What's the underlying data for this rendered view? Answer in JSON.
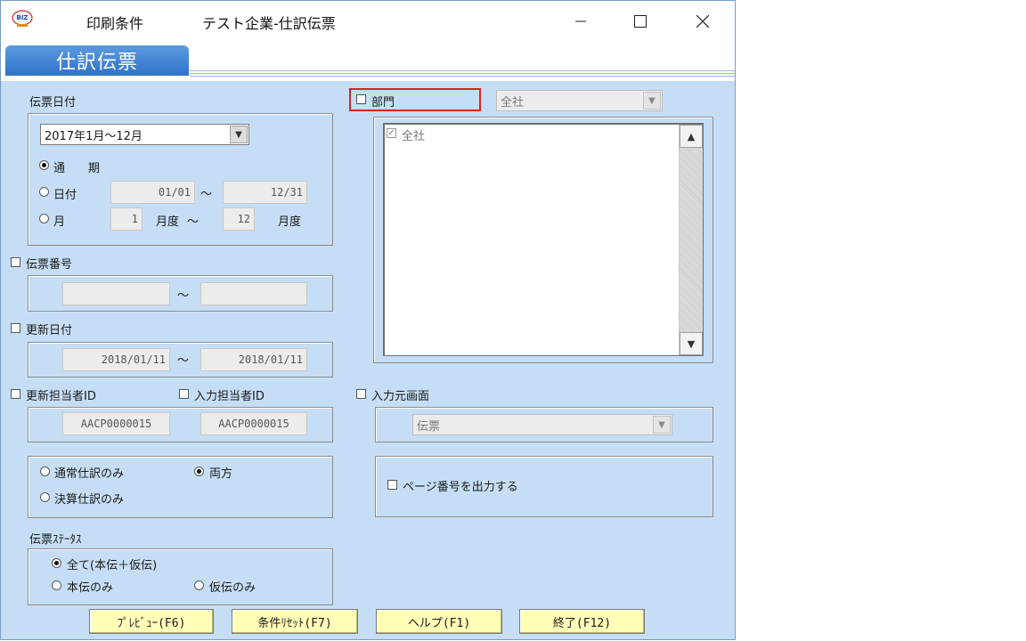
{
  "window": {
    "app_title": "印刷条件",
    "doc_title": "テスト企業-仕訳伝票",
    "minimize": "—",
    "maximize": "☐",
    "close": "✕"
  },
  "page_tab": "仕訳伝票",
  "slip_date": {
    "title": "伝票日付",
    "period_value": "2017年1月～12月",
    "radio_full": "通　　期",
    "radio_date": "日付",
    "date_from": "01/01",
    "tilde1": "～",
    "date_to": "12/31",
    "radio_month": "月",
    "month_from": "1",
    "month_unit1": "月度",
    "tilde2": "～",
    "month_to": "12",
    "month_unit2": "月度"
  },
  "slip_number": {
    "label": "伝票番号",
    "from": "",
    "tilde": "～",
    "to": ""
  },
  "update_date": {
    "label": "更新日付",
    "from": "2018/01/11",
    "tilde": "～",
    "to": "2018/01/11"
  },
  "persons": {
    "updater_label": "更新担当者ID",
    "updater_value": "AACP0000015",
    "inputter_label": "入力担当者ID",
    "inputter_value": "AACP0000015"
  },
  "journal_type": {
    "normal": "通常仕訳のみ",
    "both": "両方",
    "closing": "決算仕訳のみ"
  },
  "slip_status": {
    "title": "伝票ｽﾃｰﾀｽ",
    "all": "全て(本伝＋仮伝)",
    "main_only": "本伝のみ",
    "temp_only": "仮伝のみ"
  },
  "department": {
    "label": "部門",
    "combo_value": "全社",
    "list_items": [
      "全社"
    ]
  },
  "source_screen": {
    "label": "入力元画面",
    "combo_value": "伝票"
  },
  "page_number": {
    "label": "ページ番号を出力する"
  },
  "buttons": {
    "preview": "ﾌﾟﾚﾋﾞｭｰ(F6)",
    "reset": "条件ﾘｾｯﾄ(F7)",
    "help": "ヘルプ(F1)",
    "exit": "終了(F12)"
  },
  "icons": {
    "app": "bizup-logo-icon",
    "dropdown": "chevron-down-icon",
    "scroll_up": "scroll-up-icon",
    "scroll_down": "scroll-down-icon"
  },
  "colors": {
    "panel_bg": "#c6def5",
    "tab_blue": "#3a7fd4",
    "button_yellow": "#ffffb8",
    "highlight_red": "#e02020"
  }
}
